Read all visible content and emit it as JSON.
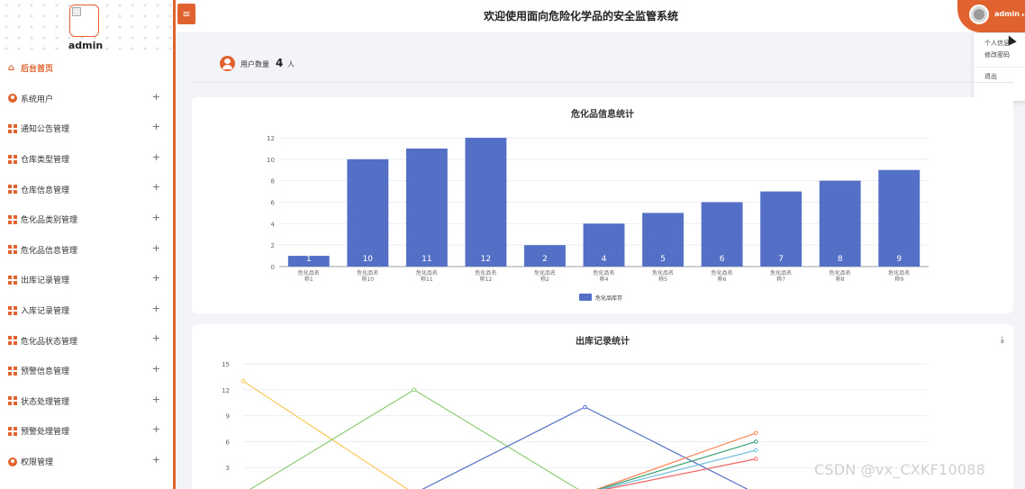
{
  "sidebar": {
    "username": "admin",
    "menu": [
      {
        "label": "后台首页",
        "icon": "home-icon",
        "active": true
      },
      {
        "label": "系统用户",
        "icon": "user-icon"
      },
      {
        "label": "通知公告管理",
        "icon": "grid-icon"
      },
      {
        "label": "仓库类型管理",
        "icon": "grid-icon"
      },
      {
        "label": "仓库信息管理",
        "icon": "grid-icon"
      },
      {
        "label": "危化品类别管理",
        "icon": "grid-icon"
      },
      {
        "label": "危化品信息管理",
        "icon": "grid-icon"
      },
      {
        "label": "出库记录管理",
        "icon": "grid-icon"
      },
      {
        "label": "入库记录管理",
        "icon": "grid-icon"
      },
      {
        "label": "危化品状态管理",
        "icon": "grid-icon"
      },
      {
        "label": "预警信息管理",
        "icon": "grid-icon"
      },
      {
        "label": "状态处理管理",
        "icon": "grid-icon"
      },
      {
        "label": "预警处理管理",
        "icon": "grid-icon"
      },
      {
        "label": "权限管理",
        "icon": "user-icon"
      }
    ],
    "expand_symbol": "+"
  },
  "header": {
    "menu_toggle_symbol": "≡",
    "title": "欢迎使用面向危险化学品的安全监管系统",
    "user_label": "admin",
    "user_caret": "▸",
    "dropdown": [
      "个人信息",
      "修改密码",
      "退出"
    ]
  },
  "stats": {
    "label": "用户数量",
    "value": "4",
    "unit": "人"
  },
  "accent_color": "#e0622f",
  "chart_data": [
    {
      "type": "bar",
      "title": "危化品信息统计",
      "categories": [
        "危化品名称1",
        "危化品名称10",
        "危化品名称11",
        "危化品名称12",
        "危化品名称2",
        "危化品名称4",
        "危化品名称5",
        "危化品名称6",
        "危化品名称7",
        "危化品名称8",
        "危化品名称9"
      ],
      "series": [
        {
          "name": "危化品库存",
          "values": [
            1,
            10,
            11,
            12,
            2,
            4,
            5,
            6,
            7,
            8,
            9
          ],
          "color": "#5470c6"
        }
      ],
      "yticks": [
        0,
        2,
        4,
        6,
        8,
        10,
        12
      ],
      "ylim": [
        0,
        12
      ],
      "data_labels": true,
      "legend": "bottom-center"
    },
    {
      "type": "line",
      "title": "出库记录统计",
      "download_icon": "download-icon",
      "yticks": [
        3,
        6,
        9,
        12,
        15
      ],
      "ylim": [
        0,
        15
      ],
      "series": [
        {
          "color": "#fac858",
          "values": [
            13,
            0,
            null,
            null,
            null
          ]
        },
        {
          "color": "#91cc75",
          "values": [
            0,
            12,
            0,
            null,
            null
          ]
        },
        {
          "color": "#5470c6",
          "values": [
            null,
            0,
            10,
            0,
            null
          ]
        },
        {
          "color": "#fc8452",
          "values": [
            null,
            null,
            0,
            7,
            null
          ]
        },
        {
          "color": "#3ba272",
          "values": [
            null,
            null,
            0,
            6,
            null
          ]
        },
        {
          "color": "#73c0de",
          "values": [
            null,
            null,
            0,
            5,
            null
          ]
        },
        {
          "color": "#ee6666",
          "values": [
            null,
            null,
            0,
            4,
            null
          ]
        }
      ]
    }
  ],
  "watermark": "CSDN @vx_CXKF10088"
}
